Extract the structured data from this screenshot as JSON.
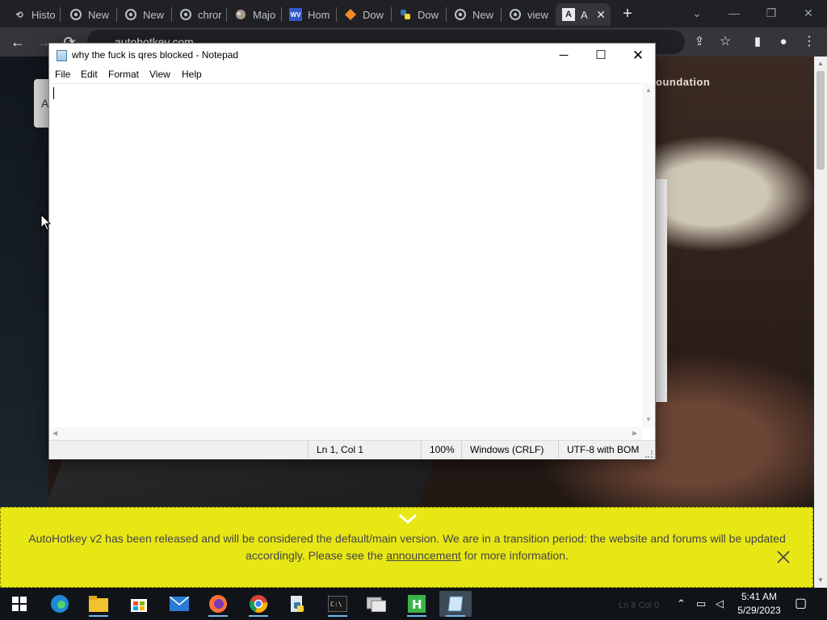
{
  "browser": {
    "tabs": [
      {
        "label": "Histo",
        "icon": "history-icon"
      },
      {
        "label": "New",
        "icon": "chrome-icon"
      },
      {
        "label": "New",
        "icon": "chrome-icon"
      },
      {
        "label": "chror",
        "icon": "chrome-icon"
      },
      {
        "label": "Majo",
        "icon": "site-icon"
      },
      {
        "label": "Hom",
        "icon": "wv-icon"
      },
      {
        "label": "Dow",
        "icon": "orange-diamond-icon"
      },
      {
        "label": "Dow",
        "icon": "python-icon"
      },
      {
        "label": "New",
        "icon": "chrome-icon"
      },
      {
        "label": "view",
        "icon": "chrome-icon"
      },
      {
        "label": "A",
        "icon": "autohotkey-icon",
        "active": true
      }
    ],
    "new_tab_symbol": "+",
    "url": "autohotkey.com"
  },
  "page": {
    "site_title": "oundation",
    "left_button_letter": "A"
  },
  "notepad": {
    "title": "why the fuck is qres blocked - Notepad",
    "menu": [
      "File",
      "Edit",
      "Format",
      "View",
      "Help"
    ],
    "content": "",
    "status": {
      "position": "Ln 1, Col 1",
      "zoom": "100%",
      "line_endings": "Windows (CRLF)",
      "encoding": "UTF-8 with BOM"
    }
  },
  "banner": {
    "text_before": "AutoHotkey v2 has been released and will be considered the default/main version. We are in a transition period: the website and forums will be updated accordingly. Please see the ",
    "link_text": "announcement",
    "text_after": " for more information."
  },
  "taskbar": {
    "apps": [
      "start",
      "edge",
      "file-explorer",
      "microsoft-store",
      "mail",
      "firefox",
      "chrome",
      "python-idle",
      "terminal",
      "window-manager",
      "hx-editor",
      "notepad"
    ],
    "ghost_text": "Ln 8    Col 0",
    "clock_time": "5:41 AM",
    "clock_date": "5/29/2023"
  },
  "colors": {
    "banner_bg": "#e7e716",
    "taskbar_bg": "#101418",
    "chrome_dark": "#202124"
  }
}
